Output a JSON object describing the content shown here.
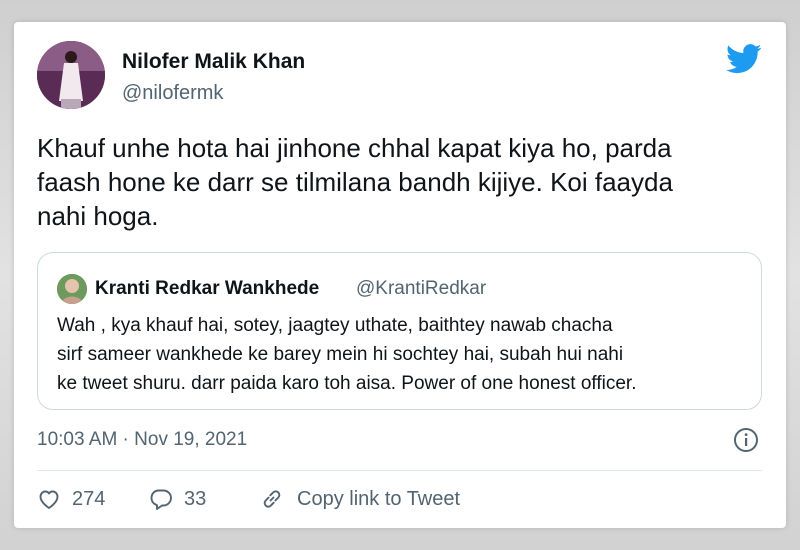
{
  "tweet": {
    "author_name": "Nilofer Malik Khan",
    "author_handle": "@nilofermk",
    "text_lines": [
      "Khauf unhe hota hai jinhone chhal kapat kiya ho, parda",
      "faash hone ke darr se tilmilana bandh kijiye. Koi faayda",
      "nahi hoga."
    ],
    "timestamp": "10:03 AM · Nov 19, 2021",
    "like_count": "274",
    "reply_count": "33",
    "copy_link_label": "Copy link to Tweet"
  },
  "quoted_tweet": {
    "author_name": "Kranti Redkar Wankhede",
    "author_handle": "@KrantiRedkar",
    "text_lines": [
      "Wah , kya khauf hai, sotey, jaagtey uthate, baithtey nawab chacha",
      "sirf sameer wankhede ke barey mein hi sochtey hai, subah hui nahi",
      "ke tweet shuru. darr paida karo toh aisa. Power of one honest officer."
    ]
  },
  "icons": {
    "brand": "twitter-bird-icon",
    "info": "info-icon",
    "like": "heart-icon",
    "reply": "reply-bubble-icon",
    "link": "link-icon"
  },
  "colors": {
    "brand": "#1d9bf0",
    "text": "#0f1419",
    "secondary": "#536471",
    "border": "#cfd9de"
  }
}
